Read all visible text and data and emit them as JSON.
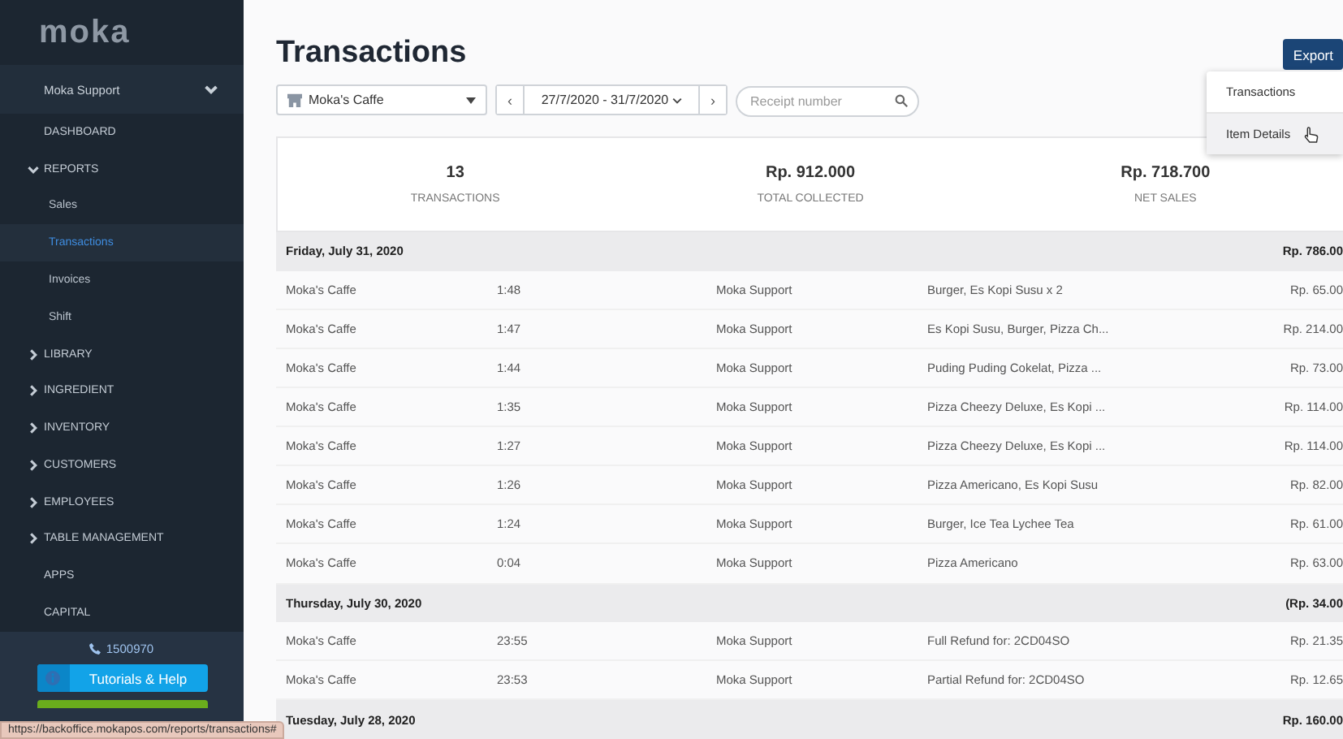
{
  "sidebar": {
    "logo": "moka",
    "account": {
      "name": "Moka Support"
    },
    "items": [
      {
        "label": "DASHBOARD",
        "kind": "link",
        "selected": false
      },
      {
        "label": "REPORTS",
        "kind": "group",
        "expanded": true,
        "selected": false
      },
      {
        "label": "Sales",
        "kind": "sub",
        "selected": false
      },
      {
        "label": "Transactions",
        "kind": "sub",
        "selected": true
      },
      {
        "label": "Invoices",
        "kind": "sub",
        "selected": false
      },
      {
        "label": "Shift",
        "kind": "sub",
        "selected": false
      },
      {
        "label": "LIBRARY",
        "kind": "group",
        "expanded": false,
        "selected": false
      },
      {
        "label": "INGREDIENT",
        "kind": "group",
        "expanded": false,
        "selected": false
      },
      {
        "label": "INVENTORY",
        "kind": "group",
        "expanded": false,
        "selected": false
      },
      {
        "label": "CUSTOMERS",
        "kind": "group",
        "expanded": false,
        "selected": false
      },
      {
        "label": "EMPLOYEES",
        "kind": "group",
        "expanded": false,
        "selected": false
      },
      {
        "label": "TABLE MANAGEMENT",
        "kind": "group",
        "expanded": false,
        "selected": false
      },
      {
        "label": "APPS",
        "kind": "link",
        "selected": false
      },
      {
        "label": "CAPITAL",
        "kind": "link",
        "selected": false
      }
    ],
    "phone": "1500970",
    "help_button": "Tutorials & Help"
  },
  "page": {
    "title": "Transactions",
    "export_button": "Export",
    "export_menu": [
      {
        "label": "Transactions",
        "selected": false
      },
      {
        "label": "Item Details",
        "selected": true
      }
    ],
    "filters": {
      "outlet": "Moka's Caffe",
      "date_range": "27/7/2020 - 31/7/2020",
      "prev": "‹",
      "next": "›",
      "search": {
        "placeholder": "Receipt number"
      }
    },
    "summary": [
      {
        "value": "13",
        "label": "TRANSACTIONS"
      },
      {
        "value": "Rp. 912.000",
        "label": "TOTAL COLLECTED"
      },
      {
        "value": "Rp. 718.700",
        "label": "NET SALES"
      }
    ],
    "groups": [
      {
        "date": "Friday, July 31, 2020",
        "total": "Rp. 786.00",
        "rows": [
          {
            "outlet": "Moka's Caffe",
            "time": "1:48",
            "staff": "Moka Support",
            "items": "Burger, Es Kopi Susu x 2",
            "amount": "Rp. 65.00"
          },
          {
            "outlet": "Moka's Caffe",
            "time": "1:47",
            "staff": "Moka Support",
            "items": "Es Kopi Susu, Burger, Pizza Ch...",
            "amount": "Rp. 214.00"
          },
          {
            "outlet": "Moka's Caffe",
            "time": "1:44",
            "staff": "Moka Support",
            "items": "Puding Puding Cokelat, Pizza ...",
            "amount": "Rp. 73.00"
          },
          {
            "outlet": "Moka's Caffe",
            "time": "1:35",
            "staff": "Moka Support",
            "items": "Pizza Cheezy Deluxe, Es Kopi ...",
            "amount": "Rp. 114.00"
          },
          {
            "outlet": "Moka's Caffe",
            "time": "1:27",
            "staff": "Moka Support",
            "items": "Pizza Cheezy Deluxe, Es Kopi ...",
            "amount": "Rp. 114.00"
          },
          {
            "outlet": "Moka's Caffe",
            "time": "1:26",
            "staff": "Moka Support",
            "items": "Pizza Americano, Es Kopi Susu",
            "amount": "Rp. 82.00"
          },
          {
            "outlet": "Moka's Caffe",
            "time": "1:24",
            "staff": "Moka Support",
            "items": "Burger, Ice Tea Lychee Tea",
            "amount": "Rp. 61.00"
          },
          {
            "outlet": "Moka's Caffe",
            "time": "0:04",
            "staff": "Moka Support",
            "items": "Pizza Americano",
            "amount": "Rp. 63.00"
          }
        ]
      },
      {
        "date": "Thursday, July 30, 2020",
        "total": "(Rp. 34.00",
        "rows": [
          {
            "outlet": "Moka's Caffe",
            "time": "23:55",
            "staff": "Moka Support",
            "items": "Full Refund for: 2CD04SO",
            "amount": "Rp. 21.35"
          },
          {
            "outlet": "Moka's Caffe",
            "time": "23:53",
            "staff": "Moka Support",
            "items": "Partial Refund for: 2CD04SO",
            "amount": "Rp. 12.65"
          }
        ]
      },
      {
        "date": "Tuesday, July 28, 2020",
        "total": "Rp. 160.00"
      }
    ]
  },
  "status_bar": "https://backoffice.mokapos.com/reports/transactions#"
}
